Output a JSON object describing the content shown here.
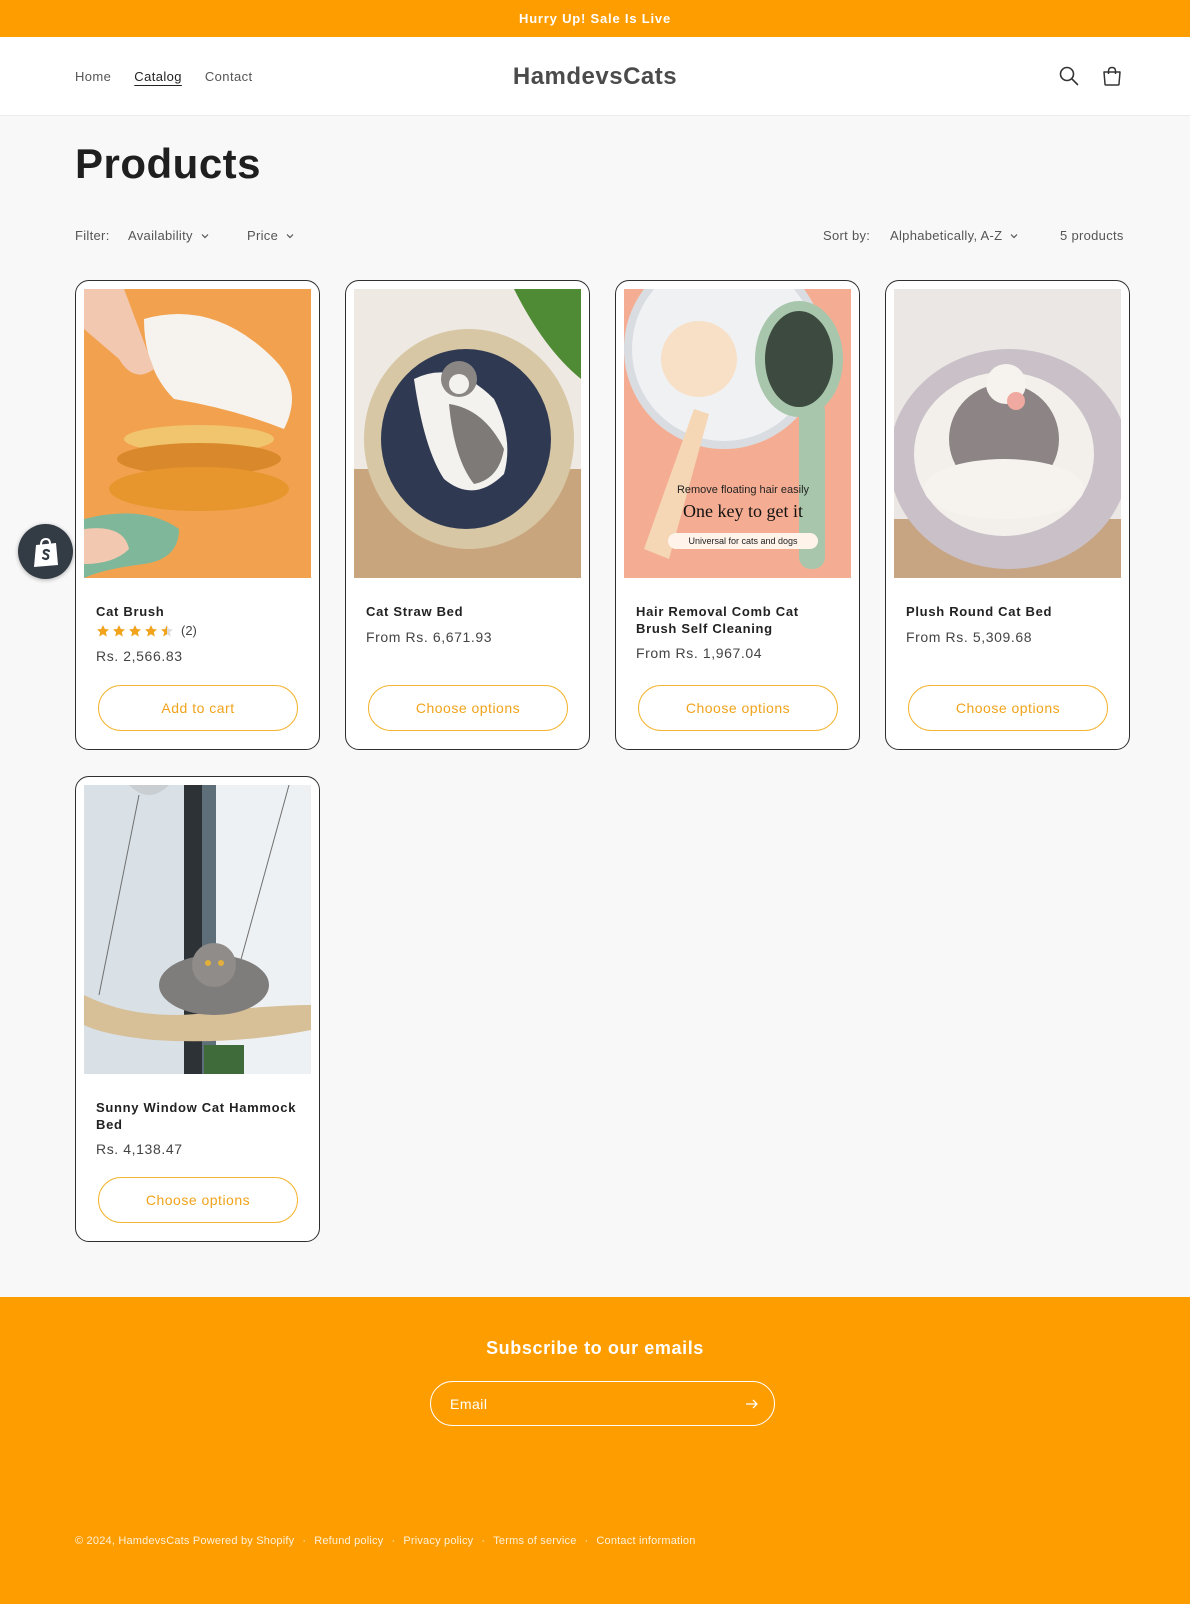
{
  "announcement": "Hurry Up! Sale Is Live",
  "header": {
    "nav": [
      "Home",
      "Catalog",
      "Contact"
    ],
    "logo": "HamdevsCats",
    "icons": [
      "search-icon",
      "cart-icon"
    ]
  },
  "page_title": "Products",
  "filters": {
    "label": "Filter:",
    "availability": "Availability",
    "price": "Price",
    "sort_label": "Sort by:",
    "sort_value": "Alphabetically, A-Z",
    "count": "5 products"
  },
  "products": [
    {
      "title": "Cat Brush",
      "rating_stars": 4.5,
      "rating_count": "(2)",
      "price": "Rs. 2,566.83",
      "button": "Add to cart"
    },
    {
      "title": "Cat Straw Bed",
      "price": "From Rs. 6,671.93",
      "button": "Choose options"
    },
    {
      "title": "Hair Removal Comb Cat Brush Self Cleaning",
      "price": "From Rs. 1,967.04",
      "button": "Choose options",
      "image_text": [
        "Remove floating hair easily",
        "One key to get it",
        "Universal for cats and dogs"
      ]
    },
    {
      "title": "Plush Round Cat Bed",
      "price": "From Rs. 5,309.68",
      "button": "Choose options"
    },
    {
      "title": "Sunny Window Cat Hammock Bed",
      "price": "Rs. 4,138.47",
      "button": "Choose options"
    }
  ],
  "footer": {
    "subscribe_title": "Subscribe to our emails",
    "email_placeholder": "Email",
    "copyright": "© 2024, HamdevsCats Powered by Shopify",
    "links": [
      "Refund policy",
      "Privacy policy",
      "Terms of service",
      "Contact information"
    ]
  },
  "colors": {
    "accent": "#fe9d00",
    "button_border": "#f3b533",
    "star": "#f0a31b"
  }
}
